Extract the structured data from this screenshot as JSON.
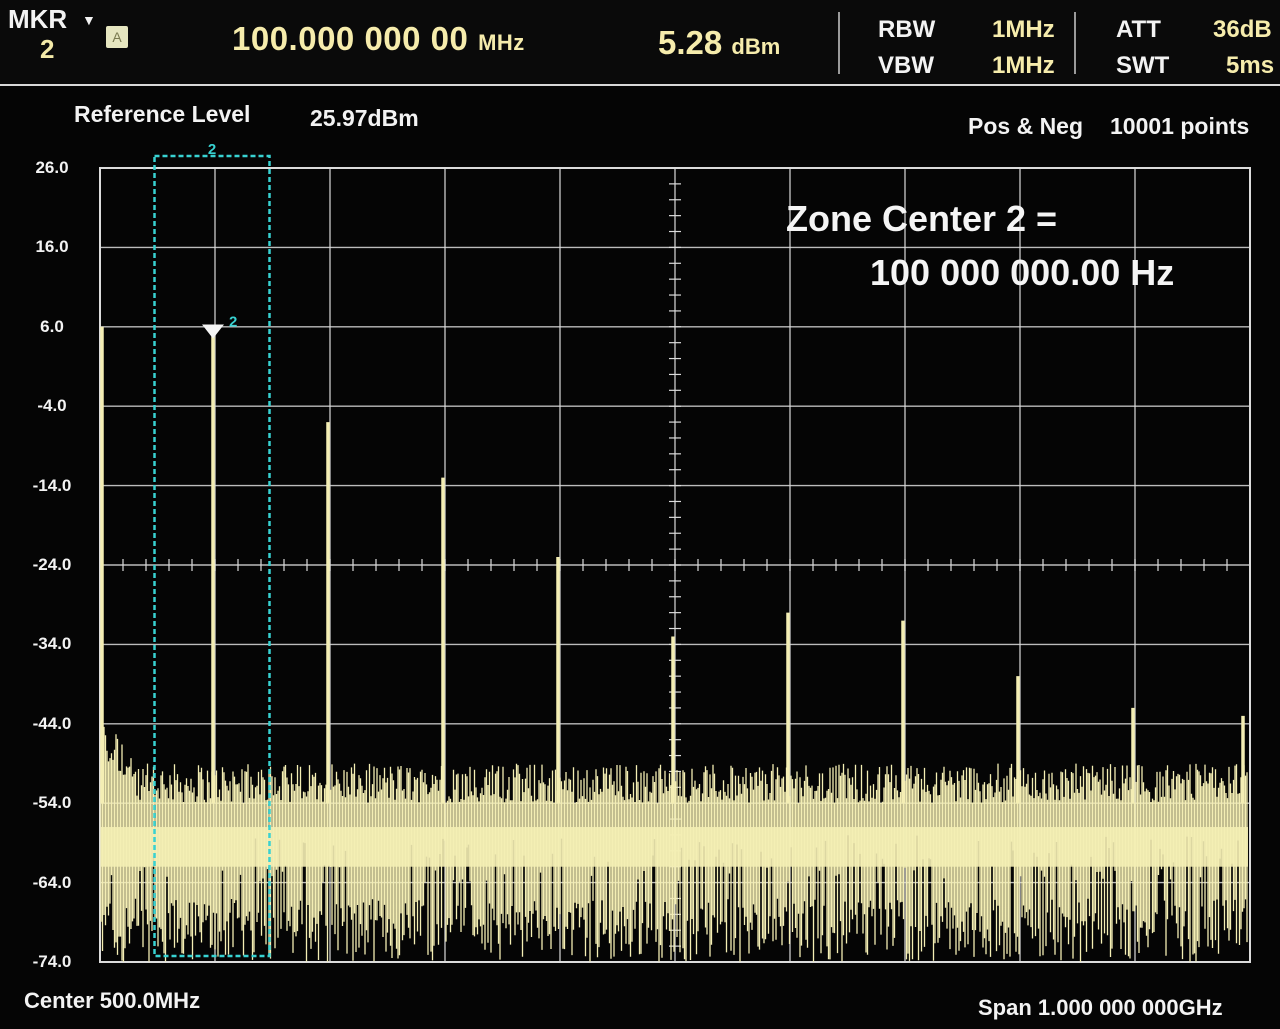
{
  "marker": {
    "label": "MKR",
    "number": "2",
    "trace_badge": "A"
  },
  "readout": {
    "frequency": "100.000 000 00",
    "frequency_unit": "MHz",
    "amplitude": "5.28",
    "amplitude_unit": "dBm"
  },
  "settings": {
    "rbw_label": "RBW",
    "rbw": "1MHz",
    "vbw_label": "VBW",
    "vbw": "1MHz",
    "att_label": "ATT",
    "att": "36dB",
    "swt_label": "SWT",
    "swt": "5ms"
  },
  "plot_header": {
    "ref_label": "Reference Level",
    "ref_value": "25.97dBm",
    "detector": "Pos & Neg",
    "points": "10001 points"
  },
  "annotation": {
    "line1": "Zone Center 2 =",
    "line2": "100 000 000.00 Hz"
  },
  "footer": {
    "center": "Center 500.0MHz",
    "span": "Span 1.000 000 000GHz"
  },
  "colors": {
    "trace": "#f4eeb4",
    "zone_box": "#38d2d2",
    "grid": "#dcdcdc",
    "background": "#050505"
  },
  "chart_data": {
    "type": "line",
    "xlabel": "",
    "ylabel": "",
    "xlim": [
      0,
      1000
    ],
    "x_unit": "MHz",
    "ylim": [
      -74,
      26
    ],
    "y_unit": "dBm",
    "yticks": [
      "26.0",
      "16.0",
      "6.0",
      "-4.0",
      "-14.0",
      "-24.0",
      "-34.0",
      "-44.0",
      "-54.0",
      "-64.0",
      "-74.0"
    ],
    "grid": true,
    "noise_floor_dbm": -60,
    "series": [
      {
        "x": [
          0,
          100,
          200,
          300,
          400,
          500,
          600,
          700,
          800,
          900,
          1000
        ],
        "y": [
          6,
          5.28,
          -6,
          -13,
          -23,
          -33,
          -30,
          -31,
          -38,
          -42,
          -43
        ]
      }
    ],
    "marker": {
      "name": "2",
      "x": 100,
      "y": 5.28
    },
    "zone": {
      "name": "2",
      "x_start": 50,
      "x_end": 150
    }
  }
}
